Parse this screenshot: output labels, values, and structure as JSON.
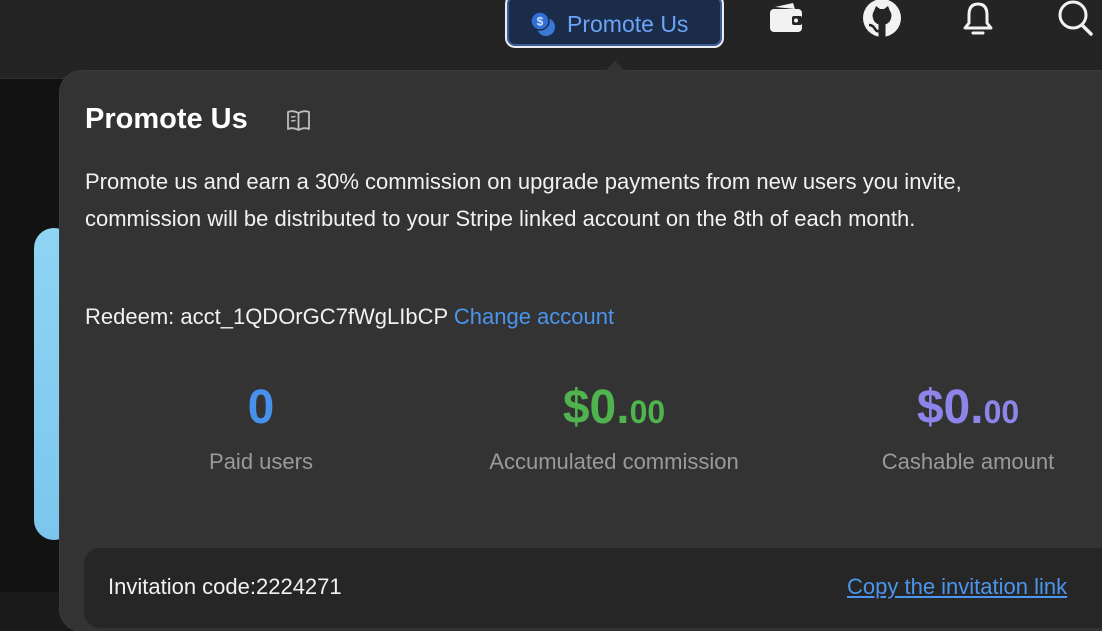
{
  "header": {
    "promote_button": {
      "label": "Promote Us",
      "icon": "dollar-coin-icon"
    },
    "icons": [
      "wallet-icon",
      "github-icon",
      "bell-icon",
      "search-icon"
    ]
  },
  "popover": {
    "title": "Promote Us",
    "title_icon": "book-icon",
    "description_line1": "Promote us and earn a 30% commission on upgrade payments from new users you invite,",
    "description_line2": "commission will be distributed to your Stripe linked account on the 8th of each month.",
    "redeem_label": "Redeem: acct_1QDOrGC7fWgLIbCP",
    "change_account_label": "Change account",
    "stats": [
      {
        "value": "0",
        "label": "Paid users",
        "color": "#4791ec"
      },
      {
        "value": "$0.",
        "cents": "00",
        "label": "Accumulated commission",
        "color": "#4fb34e"
      },
      {
        "value": "$0.",
        "cents": "00",
        "label": "Cashable amount",
        "color": "#8e85ea"
      }
    ],
    "invitation_code_label": "Invitation code:2224271",
    "copy_link_label": "Copy the invitation link"
  },
  "colors": {
    "accent_blue": "#4b95ee",
    "popover_bg": "#333333",
    "topbar_bg": "#242424"
  }
}
